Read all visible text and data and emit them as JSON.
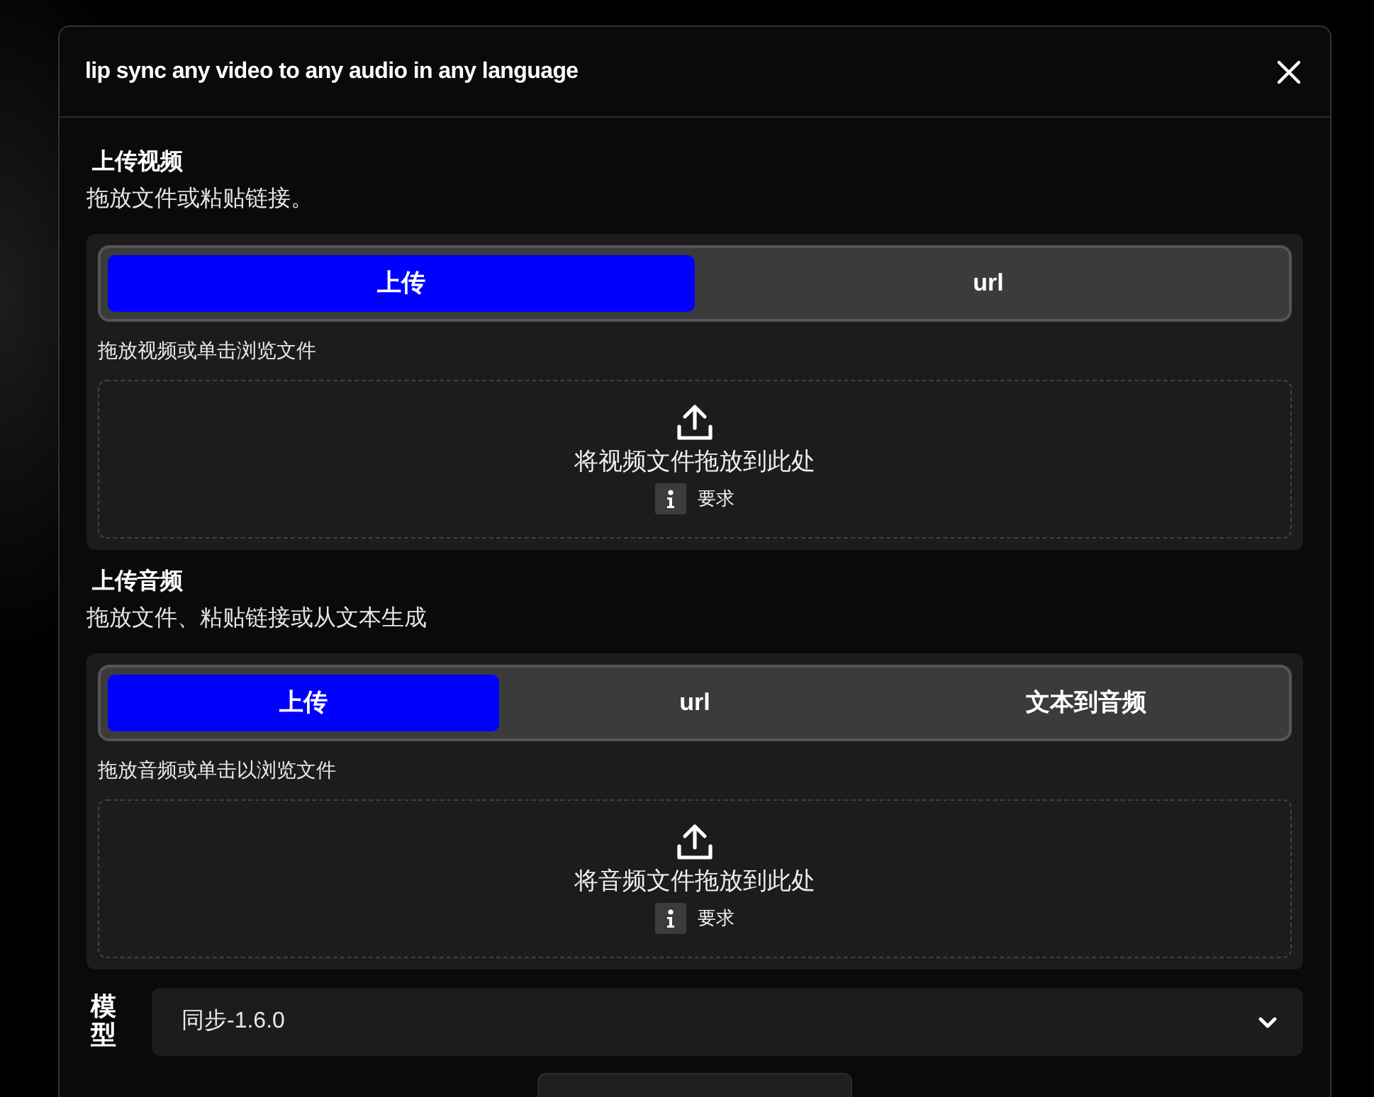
{
  "dialog": {
    "title": "lip sync any video to any audio in any language"
  },
  "sections": [
    {
      "title": "上传视频",
      "subtitle": "拖放文件或粘贴链接。",
      "tabs": [
        {
          "label": "上传",
          "selected": true
        },
        {
          "label": "url",
          "selected": false
        }
      ],
      "hint": "拖放视频或单击浏览文件",
      "dropzone": {
        "text": "将视频文件拖放到此处",
        "requirements": "要求"
      }
    },
    {
      "title": "上传音频",
      "subtitle": "拖放文件、粘贴链接或从文本生成",
      "tabs": [
        {
          "label": "上传",
          "selected": true
        },
        {
          "label": "url",
          "selected": false
        },
        {
          "label": "文本到音频",
          "selected": false
        }
      ],
      "hint": "拖放音频或单击以浏览文件",
      "dropzone": {
        "text": "将音频文件拖放到此处",
        "requirements": "要求"
      }
    }
  ],
  "model": {
    "label": "模型",
    "value": "同步-1.6.0"
  }
}
